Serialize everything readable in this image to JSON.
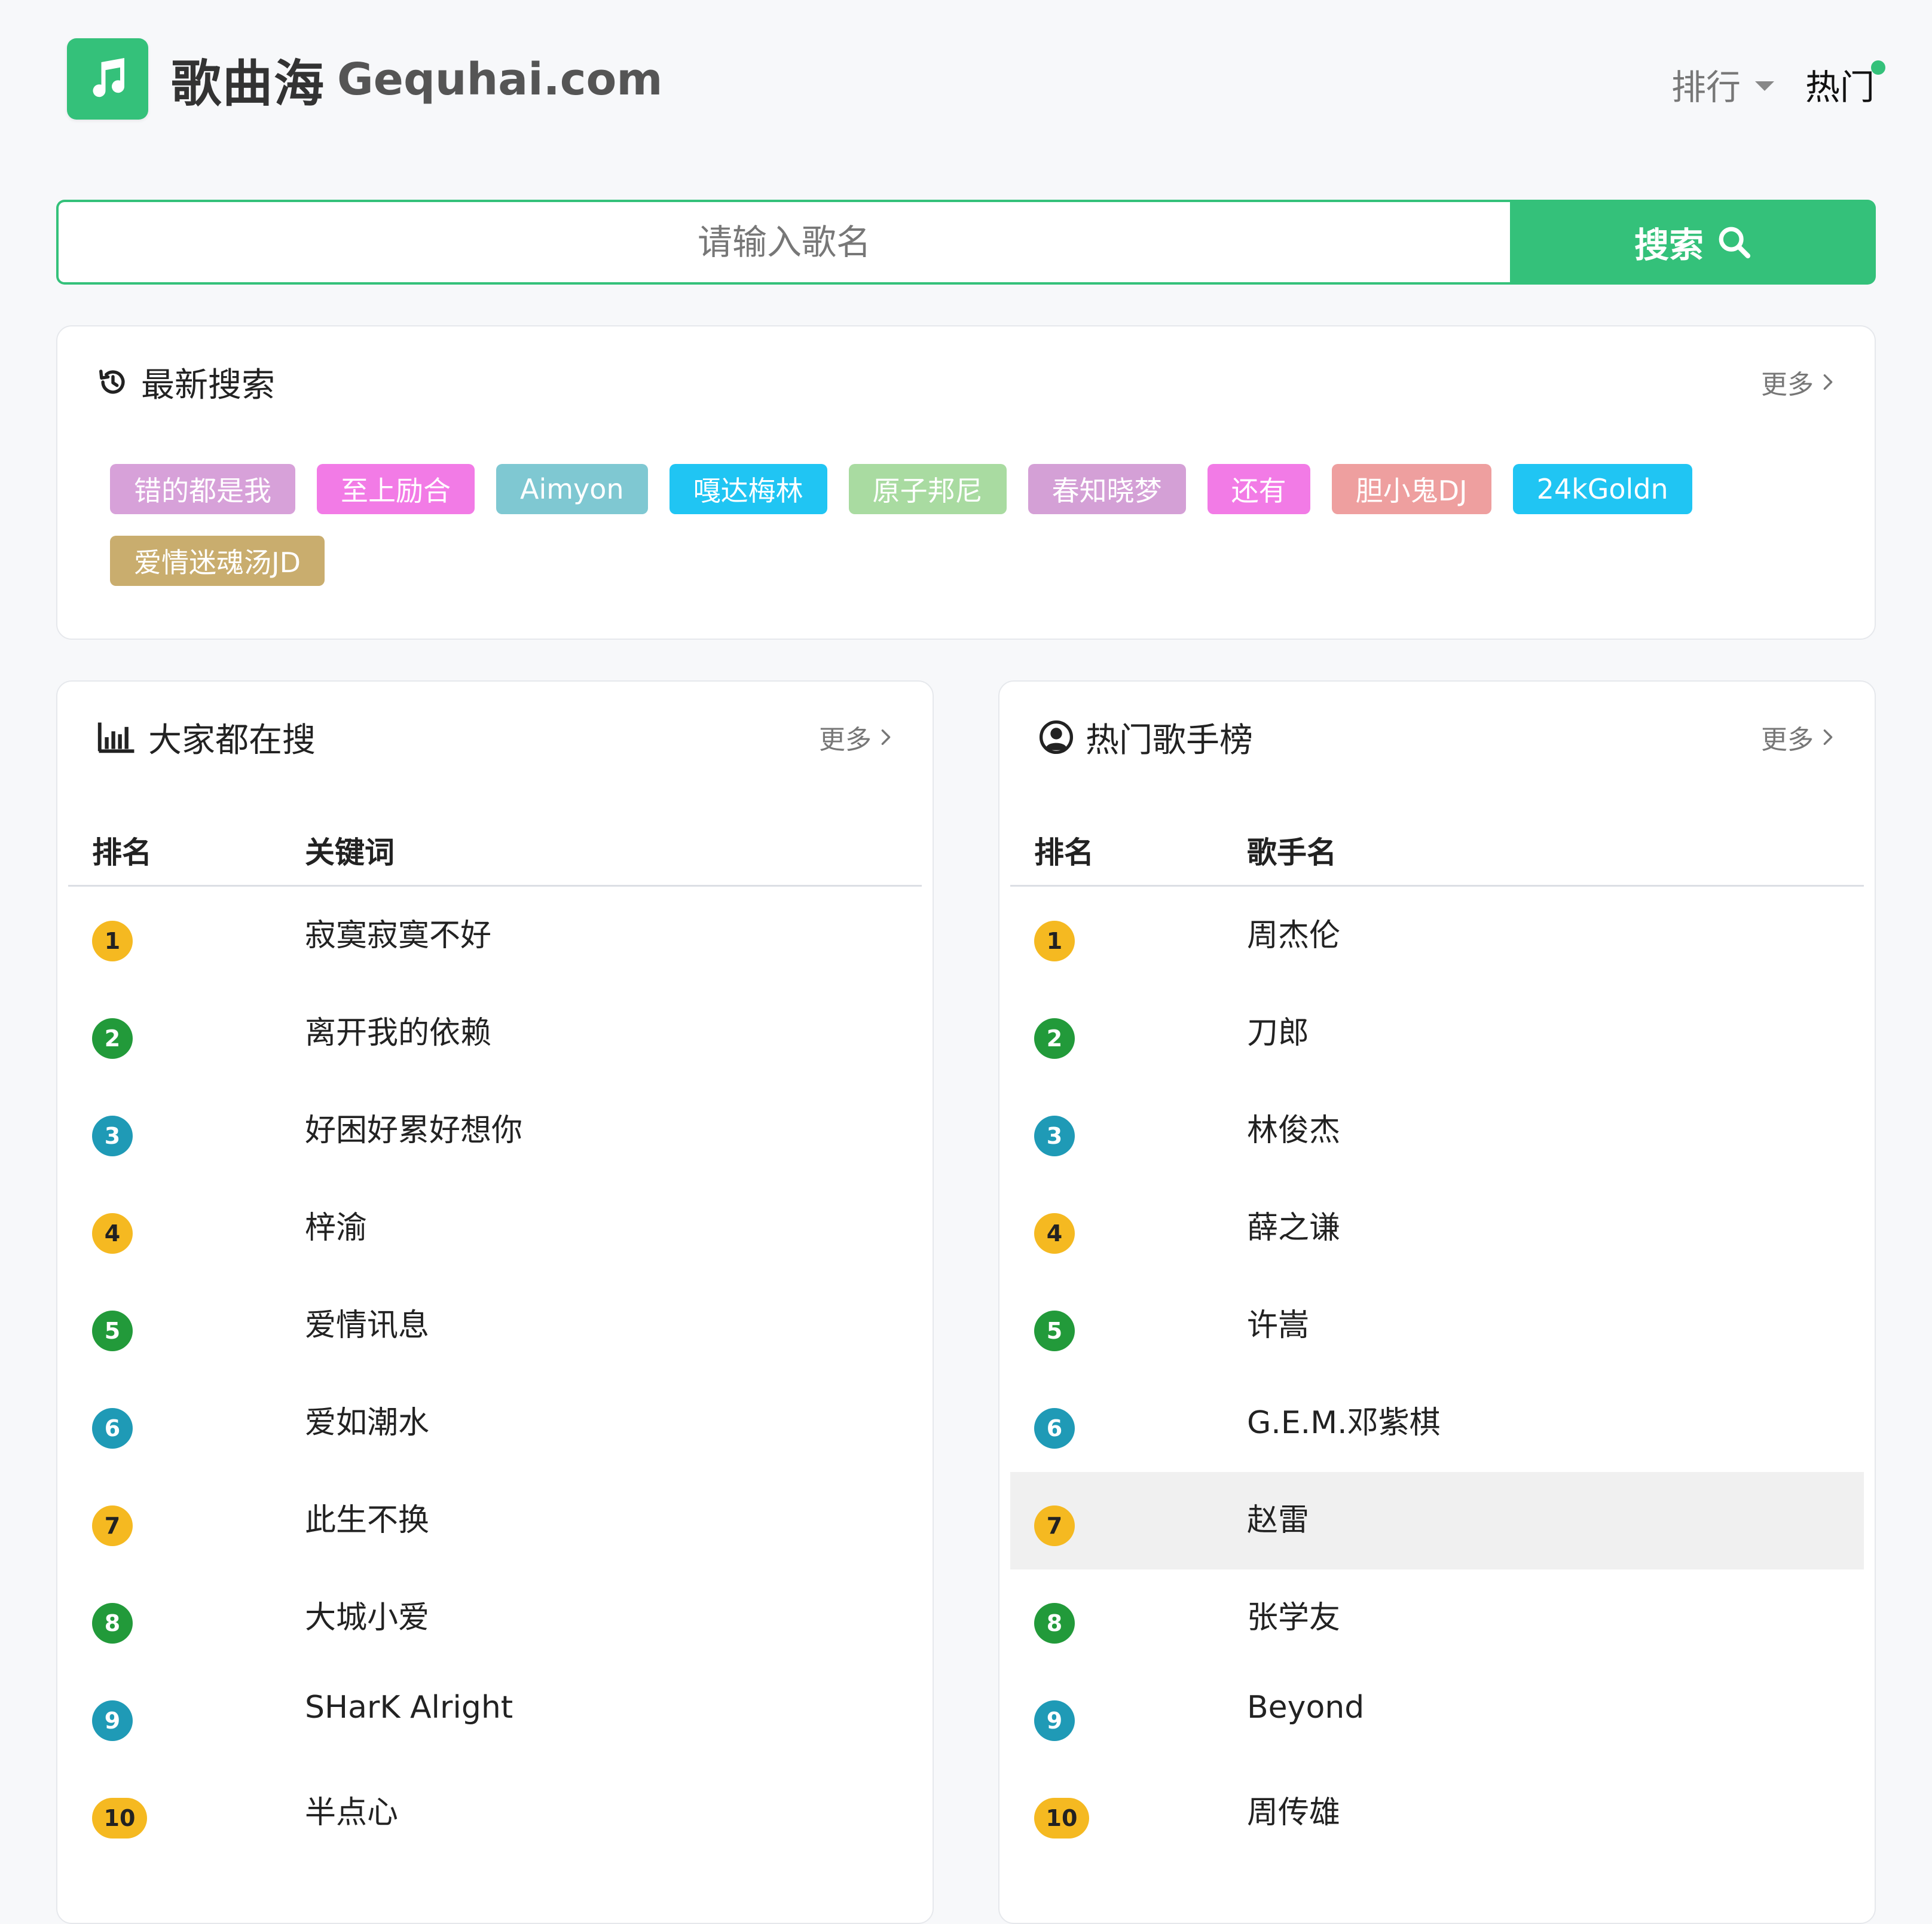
{
  "header": {
    "site_name_zh": "歌曲海",
    "site_name_en": "Gequhai.com",
    "logo_icon": "music-note-icon",
    "nav": [
      {
        "label": "排行",
        "has_dropdown": true
      },
      {
        "label": "热门",
        "has_dot": true
      }
    ]
  },
  "search": {
    "placeholder": "请输入歌名",
    "button_label": "搜索",
    "button_icon": "search-icon"
  },
  "colors": {
    "accent": "#34c17a"
  },
  "recent": {
    "title": "最新搜索",
    "icon": "history-icon",
    "more": "更多",
    "tags": [
      {
        "label": "错的都是我",
        "color": "#d7a1d9"
      },
      {
        "label": "至上励合",
        "color": "#f27be6"
      },
      {
        "label": "Aimyon",
        "color": "#7fc8d2"
      },
      {
        "label": "嘎达梅林",
        "color": "#20c5f3"
      },
      {
        "label": "原子邦尼",
        "color": "#a9dba1"
      },
      {
        "label": "春知晓梦",
        "color": "#d4a0d6"
      },
      {
        "label": "还有",
        "color": "#f27be6"
      },
      {
        "label": "胆小鬼DJ",
        "color": "#ee9f9f"
      },
      {
        "label": "24kGoldn",
        "color": "#20c5f3"
      },
      {
        "label": "爱情迷魂汤JD",
        "color": "#c9ad6e"
      }
    ]
  },
  "popular": {
    "title": "大家都在搜",
    "icon": "bar-chart-icon",
    "more": "更多",
    "col_rank": "排名",
    "col_name": "关键词",
    "rows": [
      {
        "rank": "1",
        "text": "寂寞寂寞不好"
      },
      {
        "rank": "2",
        "text": "离开我的依赖"
      },
      {
        "rank": "3",
        "text": "好困好累好想你"
      },
      {
        "rank": "4",
        "text": "梓渝"
      },
      {
        "rank": "5",
        "text": "爱情讯息"
      },
      {
        "rank": "6",
        "text": "爱如潮水"
      },
      {
        "rank": "7",
        "text": "此生不换"
      },
      {
        "rank": "8",
        "text": "大城小爱"
      },
      {
        "rank": "9",
        "text": "SHarK Alright"
      },
      {
        "rank": "10",
        "text": "半点心"
      }
    ]
  },
  "singers": {
    "title": "热门歌手榜",
    "icon": "user-circle-icon",
    "more": "更多",
    "col_rank": "排名",
    "col_name": "歌手名",
    "rows": [
      {
        "rank": "1",
        "text": "周杰伦"
      },
      {
        "rank": "2",
        "text": "刀郎"
      },
      {
        "rank": "3",
        "text": "林俊杰"
      },
      {
        "rank": "4",
        "text": "薛之谦"
      },
      {
        "rank": "5",
        "text": "许嵩"
      },
      {
        "rank": "6",
        "text": "G.E.M.邓紫棋"
      },
      {
        "rank": "7",
        "text": "赵雷"
      },
      {
        "rank": "8",
        "text": "张学友"
      },
      {
        "rank": "9",
        "text": "Beyond"
      },
      {
        "rank": "10",
        "text": "周传雄"
      }
    ]
  }
}
